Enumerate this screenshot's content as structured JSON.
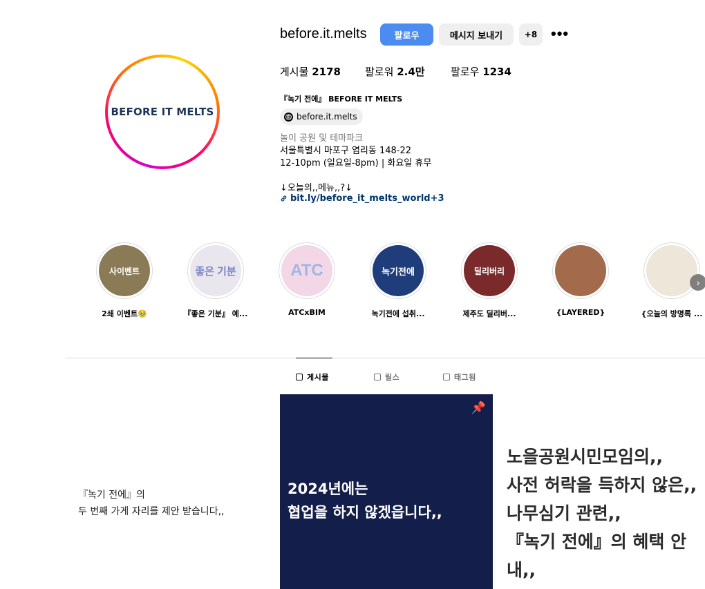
{
  "profile": {
    "username": "before.it.melts",
    "avatar_text": "BEFORE IT MELTS",
    "follow_label": "팔로우",
    "message_label": "메시지 보내기",
    "add_icon_label": "+8",
    "more_label": "•••"
  },
  "stats": {
    "posts_label": "게시물",
    "posts_value": "2178",
    "followers_label": "팔로워",
    "followers_value": "2.4만",
    "following_label": "팔로우",
    "following_value": "1234"
  },
  "bio": {
    "name": "『녹기 전에』 BEFORE IT MELTS",
    "threads_handle": "before.it.melts",
    "category": "놀이 공원 및 테마파크",
    "address": "서울특별시 마포구 염리동 148-22",
    "hours": "12-10pm (일요일-8pm) | 화요일 휴무",
    "menu_line": "↓오늘의,,메뉴,,?↓",
    "link": "bit.ly/before_it_melts_world+3"
  },
  "highlights": [
    {
      "label": "2쇄 이벤트🥹",
      "thumb_text": "사이벤트",
      "bg": "#8a7a55",
      "fg": "#ffffff"
    },
    {
      "label": "『좋은 기분』 예...",
      "thumb_text": "좋은 기분",
      "bg": "#e9e6ee",
      "fg": "#7b86c9"
    },
    {
      "label": "ATCxBIM",
      "thumb_text": "ATC",
      "bg": "#f3d7e6",
      "fg": "#9fb6e6"
    },
    {
      "label": "녹기전에 섭취...",
      "thumb_text": "녹기전에",
      "bg": "#1f3d7a",
      "fg": "#ffffff"
    },
    {
      "label": "제주도 딜리버...",
      "thumb_text": "딜리버리",
      "bg": "#7a2a2a",
      "fg": "#ffffff"
    },
    {
      "label": "{LAYERED}",
      "thumb_text": "",
      "bg": "#a36a4c",
      "fg": "#ffffff"
    },
    {
      "label": "{오늘의 방명록 ...",
      "thumb_text": "",
      "bg": "#efe6da",
      "fg": "#555555"
    }
  ],
  "tabs": [
    {
      "label": "게시물"
    },
    {
      "label": "릴스"
    },
    {
      "label": "태그됨"
    }
  ],
  "posts": {
    "left_line1": "『녹기 전에』의",
    "left_line2": "두 번째 가게 자리를 제안 받습니다,,",
    "mid_line1": "2024년에는",
    "mid_line2": "협업을 하지 않겠읍니다,,",
    "right_line1": "노을공원시민모임의,,",
    "right_line2": "사전 허락을 득하지 않은,,",
    "right_line3": "나무심기 관련,,",
    "right_line4": "『녹기 전에』의 혜택 안내,,"
  },
  "colors": {
    "accent": "#4a8cf0",
    "link": "#00376b",
    "post_navy": "#131e4a"
  }
}
